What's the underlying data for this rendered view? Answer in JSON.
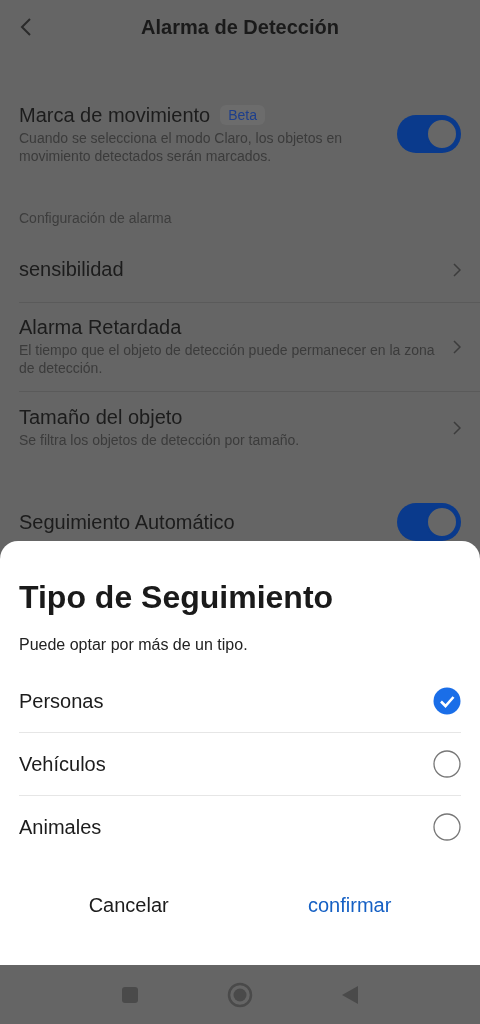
{
  "header": {
    "title": "Alarma de Detección"
  },
  "motion_mark": {
    "title": "Marca de movimiento",
    "badge": "Beta",
    "description": "Cuando se selecciona el modo Claro, los objetos en movimiento detectados serán marcados.",
    "on": true
  },
  "alarm_settings": {
    "label": "Configuración de alarma",
    "items": [
      {
        "title": "sensibilidad"
      },
      {
        "title": "Alarma Retardada",
        "description": "El tiempo que el objeto de detección puede permanecer en la zona de detección."
      },
      {
        "title": "Tamaño del objeto",
        "description": "Se filtra los objetos de detección por tamaño."
      }
    ]
  },
  "auto_tracking": {
    "title": "Seguimiento Automático",
    "on": true
  },
  "sheet": {
    "title": "Tipo de Seguimiento",
    "subtitle": "Puede optar por más de un tipo.",
    "options": [
      {
        "label": "Personas",
        "checked": true
      },
      {
        "label": "Vehículos",
        "checked": false
      },
      {
        "label": "Animales",
        "checked": false
      }
    ],
    "buttons": [
      {
        "label": "Cancelar",
        "kind": "cancel"
      },
      {
        "label": "confirmar",
        "kind": "confirm"
      }
    ]
  }
}
